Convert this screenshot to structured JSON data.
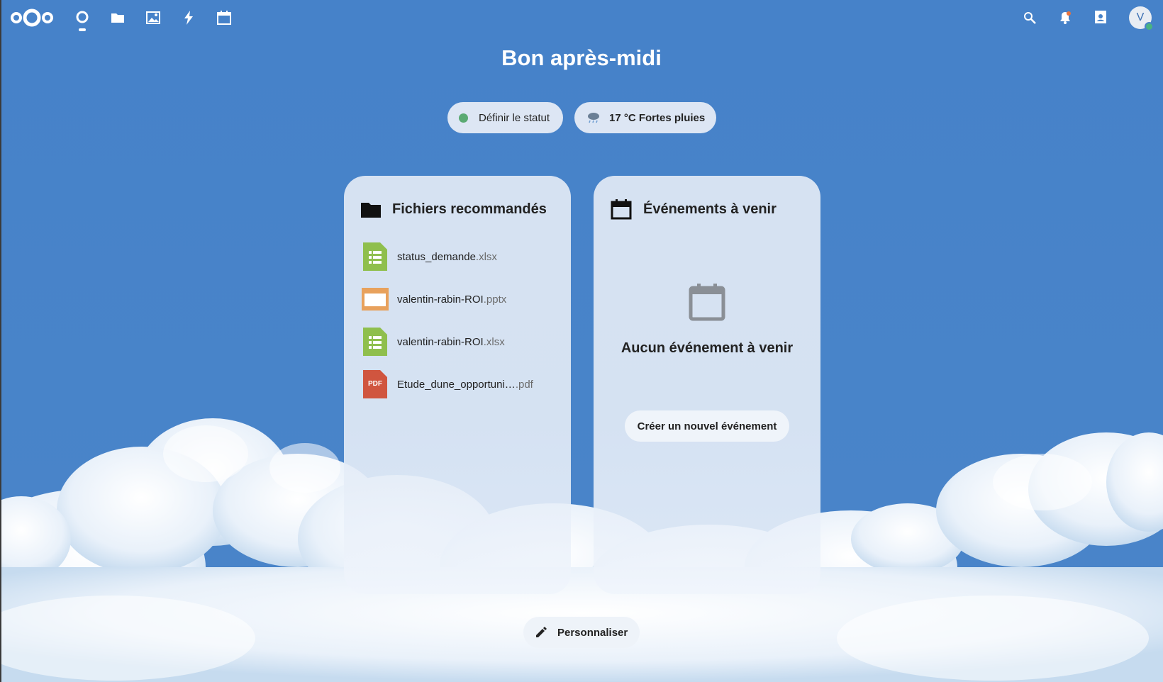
{
  "header": {
    "apps": [
      {
        "name": "Tableau de bord",
        "icon": "dashboard-icon"
      },
      {
        "name": "Fichiers",
        "icon": "folder-icon"
      },
      {
        "name": "Photos",
        "icon": "image-icon"
      },
      {
        "name": "Activité",
        "icon": "lightning-icon"
      },
      {
        "name": "Agenda",
        "icon": "calendar-icon"
      }
    ],
    "right_icons": [
      "search-icon",
      "bell-icon",
      "contacts-icon"
    ],
    "avatar_initial": "V"
  },
  "greeting": "Bon après-midi",
  "status_button": "Définir le statut",
  "weather": "17 °C Fortes pluies",
  "files_panel": {
    "title": "Fichiers recommandés",
    "files": [
      {
        "name": "status_demande",
        "ext": ".xlsx",
        "type": "spreadsheet"
      },
      {
        "name": "valentin-rabin-ROI",
        "ext": ".pptx",
        "type": "presentation"
      },
      {
        "name": "valentin-rabin-ROI",
        "ext": ".xlsx",
        "type": "spreadsheet"
      },
      {
        "name": "Etude_dune_opportuni…",
        "ext": ".pdf",
        "type": "pdf",
        "badge": "PDF"
      }
    ]
  },
  "events_panel": {
    "title": "Événements à venir",
    "empty": "Aucun événement à venir",
    "create_button": "Créer un nouvel événement"
  },
  "customize_button": "Personnaliser",
  "colors": {
    "background": "#4682c9",
    "spreadsheet": "#8fbf4d",
    "presentation": "#e8a15c",
    "pdf": "#d0553f",
    "online": "#49b382"
  }
}
